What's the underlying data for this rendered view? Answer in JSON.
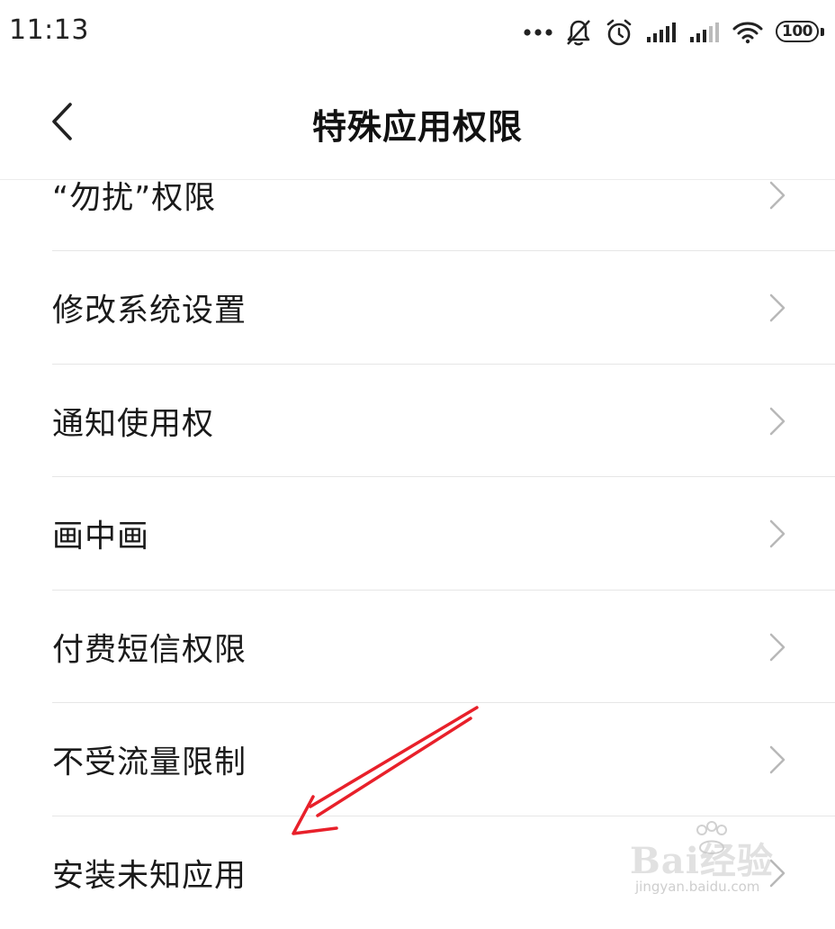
{
  "status_bar": {
    "time": "11:13",
    "battery": "100",
    "icons": [
      "more-dots-icon",
      "mute-bell-icon",
      "alarm-icon",
      "signal-icon",
      "signal-icon",
      "wifi-icon",
      "battery-icon"
    ]
  },
  "header": {
    "title": "特殊应用权限",
    "back_icon": "back-chevron-icon"
  },
  "list": {
    "items": [
      {
        "label": "“勿扰”权限"
      },
      {
        "label": "修改系统设置"
      },
      {
        "label": "通知使用权"
      },
      {
        "label": "画中画"
      },
      {
        "label": "付费短信权限"
      },
      {
        "label": "不受流量限制"
      },
      {
        "label": "安装未知应用"
      }
    ]
  },
  "watermark": {
    "main": "Bai经验",
    "sub": "jingyan.baidu.com"
  },
  "colors": {
    "annotation_arrow": "#e8202a",
    "text": "#1a1a1a",
    "divider": "#e6e6e6",
    "chevron": "#b8b8b8"
  }
}
